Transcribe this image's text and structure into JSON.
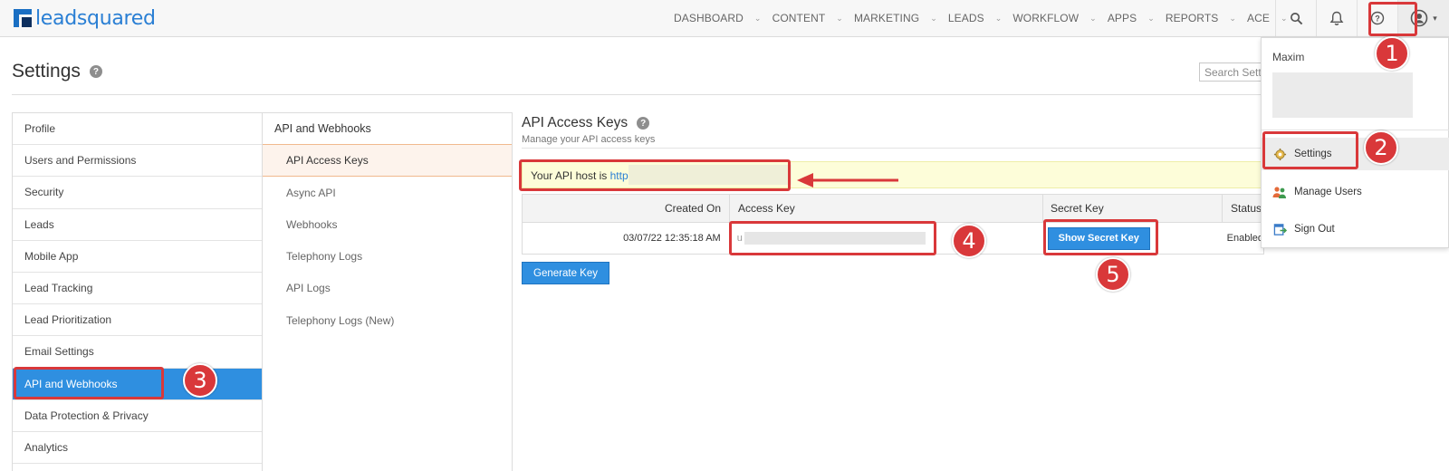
{
  "brand": {
    "name": "leadsquared"
  },
  "nav": {
    "items": [
      {
        "label": "DASHBOARD"
      },
      {
        "label": "CONTENT"
      },
      {
        "label": "MARKETING"
      },
      {
        "label": "LEADS"
      },
      {
        "label": "WORKFLOW"
      },
      {
        "label": "APPS"
      },
      {
        "label": "REPORTS"
      },
      {
        "label": "ACE"
      }
    ]
  },
  "icons": {
    "search": "search-icon",
    "bell": "bell-icon",
    "help": "help-icon",
    "user": "user-circle-icon"
  },
  "page": {
    "title": "Settings",
    "help": "?",
    "search_placeholder": "Search Setti"
  },
  "sidebar": {
    "items": [
      {
        "label": "Profile"
      },
      {
        "label": "Users and Permissions"
      },
      {
        "label": "Security"
      },
      {
        "label": "Leads"
      },
      {
        "label": "Mobile App"
      },
      {
        "label": "Lead Tracking"
      },
      {
        "label": "Lead Prioritization"
      },
      {
        "label": "Email Settings"
      },
      {
        "label": "API and Webhooks",
        "active": true
      },
      {
        "label": "Data Protection & Privacy"
      },
      {
        "label": "Analytics"
      }
    ]
  },
  "subnav": {
    "heading": "API and Webhooks",
    "items": [
      {
        "label": "API Access Keys",
        "active": true
      },
      {
        "label": "Async API"
      },
      {
        "label": "Webhooks"
      },
      {
        "label": "Telephony Logs"
      },
      {
        "label": "API Logs"
      },
      {
        "label": "Telephony Logs (New)"
      }
    ]
  },
  "main": {
    "title": "API Access Keys",
    "help": "?",
    "subtitle": "Manage your API access keys",
    "api_host_prefix": "Your API host is ",
    "api_host_link": "http",
    "table": {
      "headers": [
        "Created On",
        "Access Key",
        "Secret Key",
        "Status"
      ],
      "rows": [
        {
          "created_on": "03/07/22 12:35:18 AM",
          "access_key_prefix": "u",
          "secret_button": "Show Secret Key",
          "status": "Enabled"
        }
      ]
    },
    "generate_button": "Generate Key"
  },
  "user_menu": {
    "name": "Maxim",
    "items": [
      {
        "label": "Settings",
        "icon": "gear-icon"
      },
      {
        "label": "Manage Users",
        "icon": "users-icon"
      },
      {
        "label": "Sign Out",
        "icon": "sign-out-icon"
      }
    ]
  },
  "annotations": {
    "color": "#d9383a",
    "steps": [
      "1",
      "2",
      "3",
      "4",
      "5"
    ]
  },
  "colors": {
    "accent": "#2f8fe0",
    "brand": "#2a7fd4",
    "annotation": "#d9383a"
  }
}
